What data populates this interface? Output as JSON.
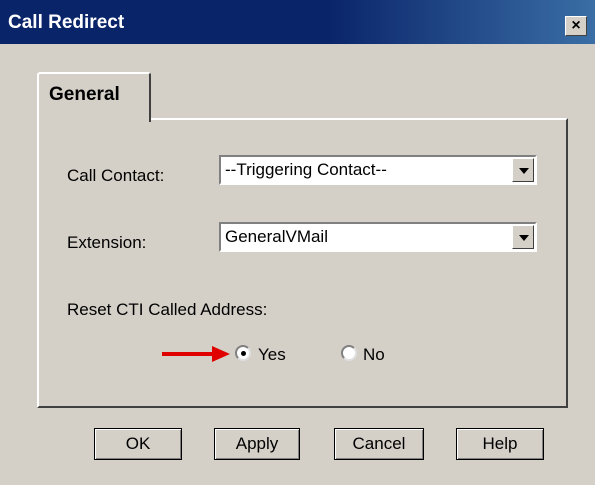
{
  "window": {
    "title": "Call Redirect",
    "close_glyph": "×"
  },
  "tabs": [
    {
      "label": "General",
      "selected": true
    }
  ],
  "form": {
    "call_contact": {
      "label": "Call Contact:",
      "value": "--Triggering Contact--"
    },
    "extension": {
      "label": "Extension:",
      "value": "GeneralVMail"
    },
    "reset_cti": {
      "label": "Reset CTI Called Address:",
      "options": [
        {
          "label": "Yes",
          "selected": true
        },
        {
          "label": "No",
          "selected": false
        }
      ]
    }
  },
  "buttons": {
    "ok": "OK",
    "apply": "Apply",
    "cancel": "Cancel",
    "help": "Help"
  },
  "colors": {
    "titlebar": "#0a246a",
    "dialog_bg": "#d4d0c8",
    "annotation_arrow": "#e00000"
  },
  "icons": {
    "close": "close-icon",
    "dropdown": "chevron-down-icon",
    "annotation": "red-arrow-icon"
  }
}
